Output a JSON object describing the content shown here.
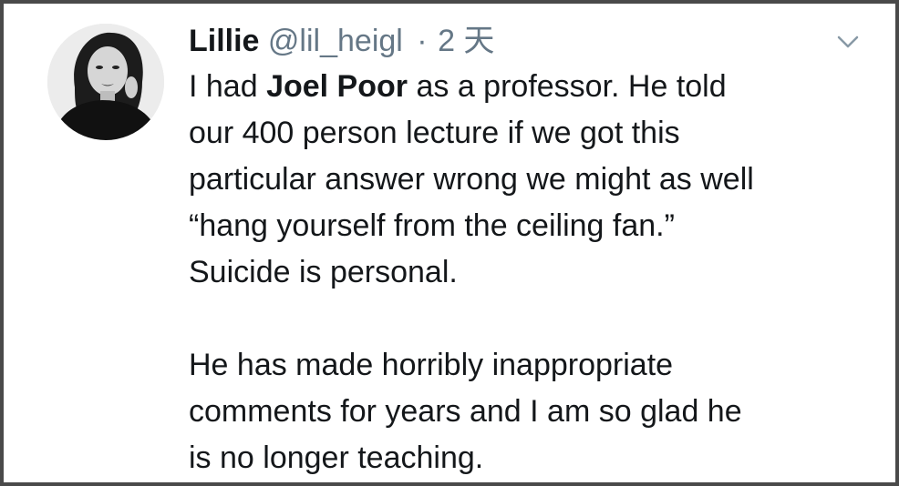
{
  "tweet": {
    "author_name": "Lillie",
    "author_handle": "@lil_heigl",
    "separator": "·",
    "timestamp": "2 天",
    "menu_icon": "chevron-down-icon",
    "avatar_icon": "user-avatar",
    "body": {
      "p1_before": "I had ",
      "p1_bold": "Joel Poor",
      "p1_line1_after": " as a professor. He told",
      "p1_line2": "our 400 person lecture if we got this",
      "p1_line3": "particular answer wrong we might as well",
      "p1_line4": "“hang yourself from the ceiling fan.”",
      "p1_line5": "Suicide is personal.",
      "p2_line1": "He has made horribly inappropriate",
      "p2_line2": "comments for years and I am so glad he",
      "p2_line3": "is no longer teaching."
    },
    "colors": {
      "text": "#14171a",
      "secondary": "#657786",
      "border": "#4a4a4a"
    }
  }
}
